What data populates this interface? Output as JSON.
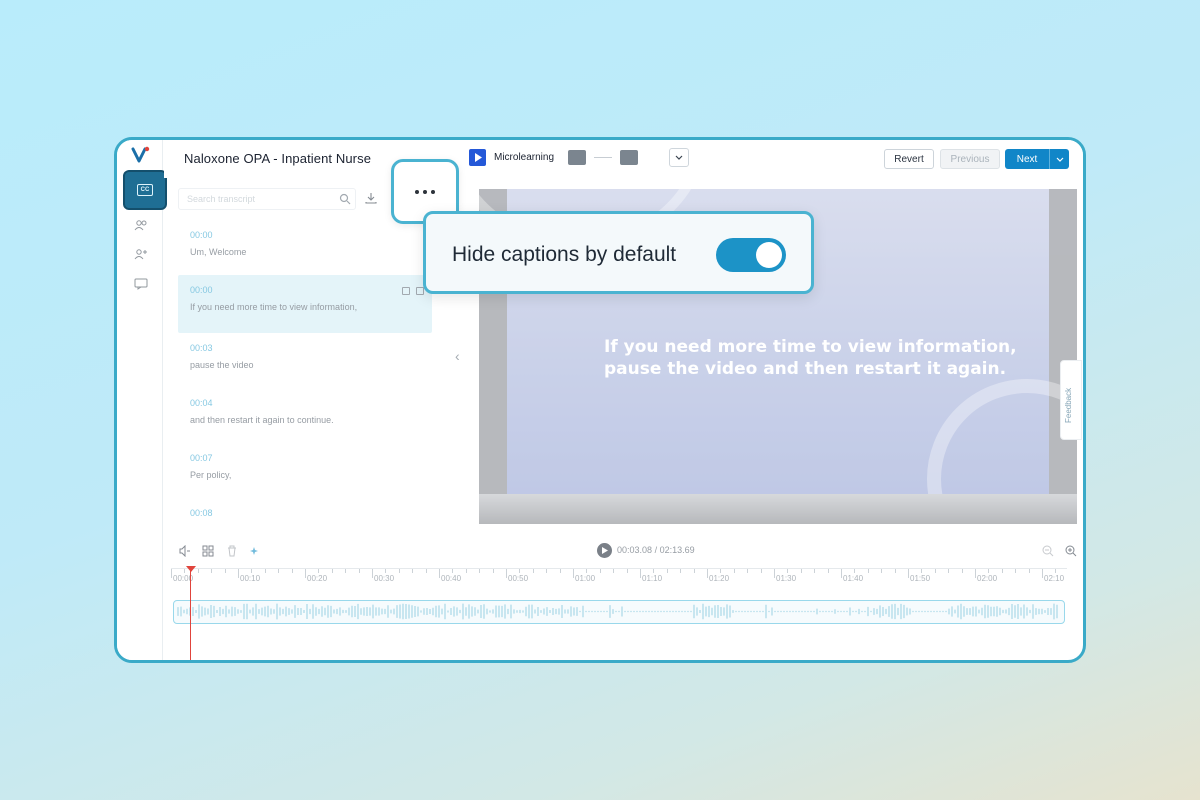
{
  "header": {
    "title": "Naloxone OPA - Inpatient Nurse",
    "mode_label": "Microlearning",
    "revert_label": "Revert",
    "previous_label": "Previous",
    "next_label": "Next"
  },
  "sidebar": {
    "items": [
      {
        "icon": "cc-icon",
        "active": true
      },
      {
        "icon": "users-icon",
        "active": false
      },
      {
        "icon": "user-add-icon",
        "active": false
      },
      {
        "icon": "chat-icon",
        "active": false
      }
    ]
  },
  "search": {
    "placeholder": "Search transcript"
  },
  "transcript": [
    {
      "time": "00:00",
      "text": "Um, Welcome"
    },
    {
      "time": "00:00",
      "text": "If you need more time to view information,",
      "selected": true
    },
    {
      "time": "00:03",
      "text": "pause the video"
    },
    {
      "time": "00:04",
      "text": "and then restart it again to continue."
    },
    {
      "time": "00:07",
      "text": "Per policy,"
    },
    {
      "time": "00:08",
      "text": ""
    }
  ],
  "video": {
    "caption_line1": "If you need more time to view information,",
    "caption_line2": "pause the video and then restart it again."
  },
  "feedback": {
    "label": "Feedback"
  },
  "timeline": {
    "current_time": "00:03.08",
    "total_time": "/ 02:13.69",
    "ticks": [
      "00:00",
      "00:10",
      "00:20",
      "00:30",
      "00:40",
      "00:50",
      "01:00",
      "01:10",
      "01:20",
      "01:30",
      "01:40",
      "01:50",
      "02:00",
      "02:10"
    ]
  },
  "popup": {
    "label": "Hide captions by default",
    "toggle_on": true
  },
  "colors": {
    "accent": "#1c93c7",
    "border_highlight": "#4ab3d1",
    "playhead": "#e0443c",
    "active_rail": "#1f6e94"
  }
}
